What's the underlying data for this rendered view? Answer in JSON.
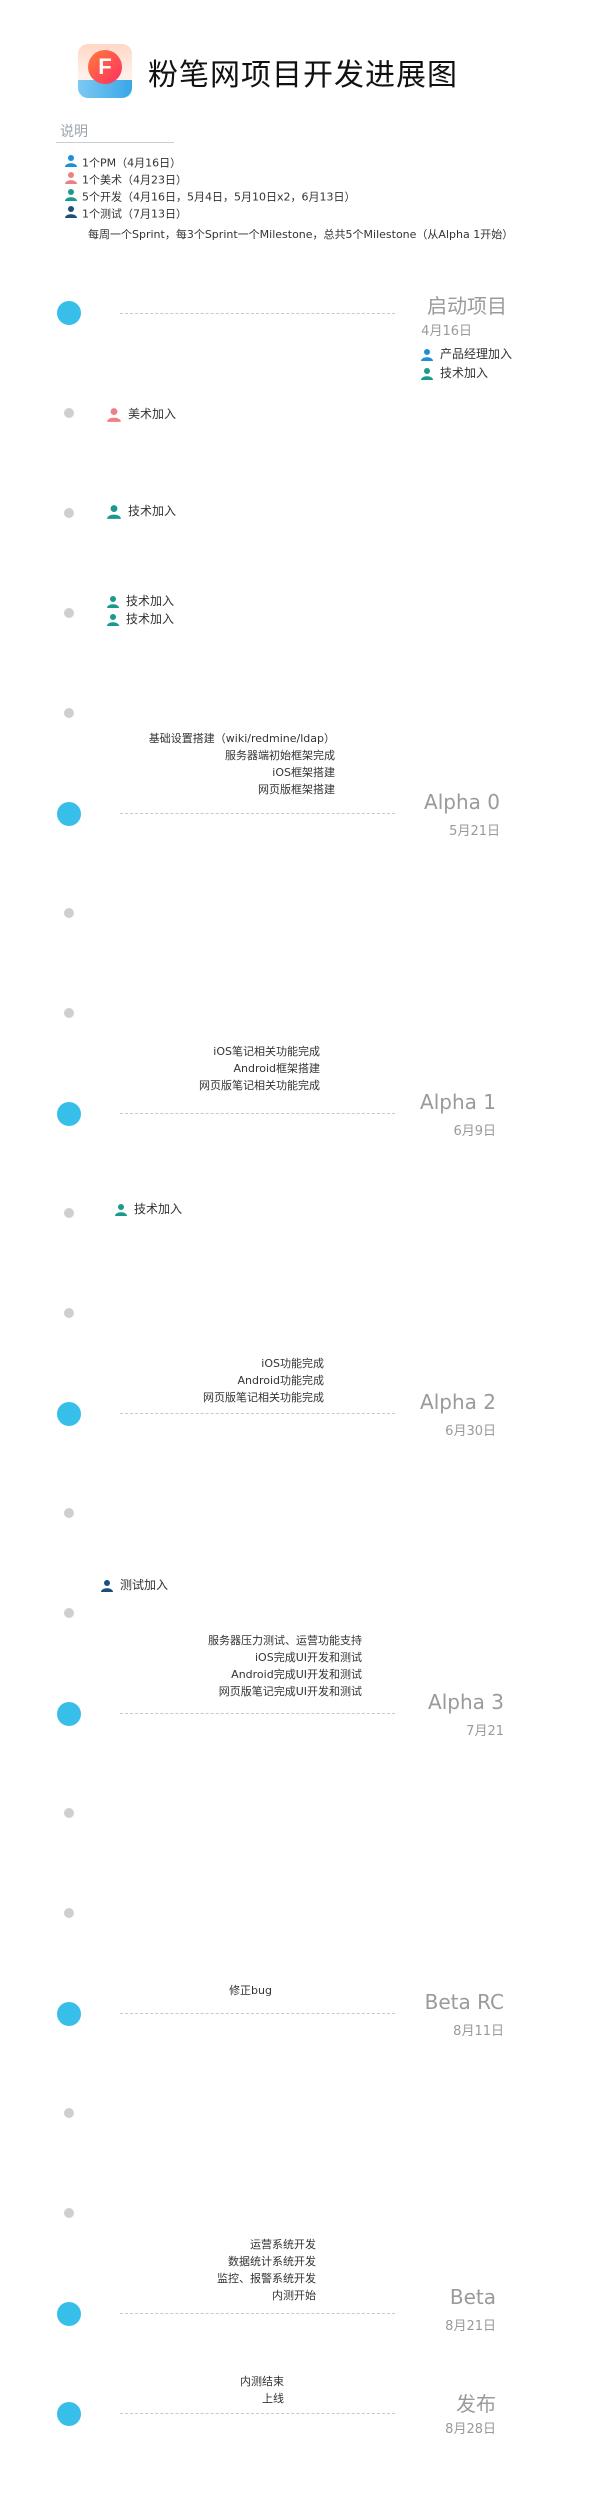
{
  "title": "粉笔网项目开发进展图",
  "logo": {
    "letter": "F"
  },
  "legend": {
    "heading": "说明",
    "rows": [
      {
        "color": "#1e90d8",
        "text": "1个PM（4月16日）"
      },
      {
        "color": "#ef7f86",
        "text": "1个美术（4月23日）"
      },
      {
        "color": "#1a9a8e",
        "text": "5个开发（4月16日，5月4日，5月10日x2，6月13日）"
      },
      {
        "color": "#1c4f7c",
        "text": "1个测试（7月13日）"
      }
    ],
    "note": "每周一个Sprint，每3个Sprint一个Milestone，总共5个Milestone（从Alpha 1开始）"
  },
  "milestones": [
    {
      "title": "启动项目",
      "date": "4月16日"
    },
    {
      "title": "Alpha 0",
      "date": "5月21日"
    },
    {
      "title": "Alpha 1",
      "date": "6月9日"
    },
    {
      "title": "Alpha 2",
      "date": "6月30日"
    },
    {
      "title": "Alpha 3",
      "date": "7月21"
    },
    {
      "title": "Beta RC",
      "date": "8月11日"
    },
    {
      "title": "Beta",
      "date": "8月21日"
    },
    {
      "title": "发布",
      "date": "8月28日"
    }
  ],
  "tasks": {
    "alpha0": [
      "基础设置搭建（wiki/redmine/ldap）",
      "服务器端初始框架完成",
      "iOS框架搭建",
      "网页版框架搭建"
    ],
    "alpha1": [
      "iOS笔记相关功能完成",
      "Android框架搭建",
      "网页版笔记相关功能完成"
    ],
    "alpha2": [
      "iOS功能完成",
      "Android功能完成",
      "网页版笔记相关功能完成"
    ],
    "alpha3": [
      "服务器压力测试、运营功能支持",
      "iOS完成UI开发和测试",
      "Android完成UI开发和测试",
      "网页版笔记完成UI开发和测试"
    ],
    "betarc": [
      "修正bug"
    ],
    "beta": [
      "运营系统开发",
      "数据统计系统开发",
      "监控、报警系统开发",
      "内测开始"
    ],
    "release": [
      "内测结束",
      "上线"
    ]
  },
  "people": {
    "start_pm": {
      "color": "#1e90d8",
      "text": "产品经理加入"
    },
    "start_dev": {
      "color": "#1a9a8e",
      "text": "技术加入"
    },
    "art": {
      "color": "#ef7f86",
      "text": "美术加入"
    },
    "dev1": {
      "color": "#1a9a8e",
      "text": "技术加入"
    },
    "dev2a": {
      "color": "#1a9a8e",
      "text": "技术加入"
    },
    "dev2b": {
      "color": "#1a9a8e",
      "text": "技术加入"
    },
    "dev3": {
      "color": "#1a9a8e",
      "text": "技术加入"
    },
    "qa": {
      "color": "#1c4f7c",
      "text": "测试加入"
    }
  }
}
